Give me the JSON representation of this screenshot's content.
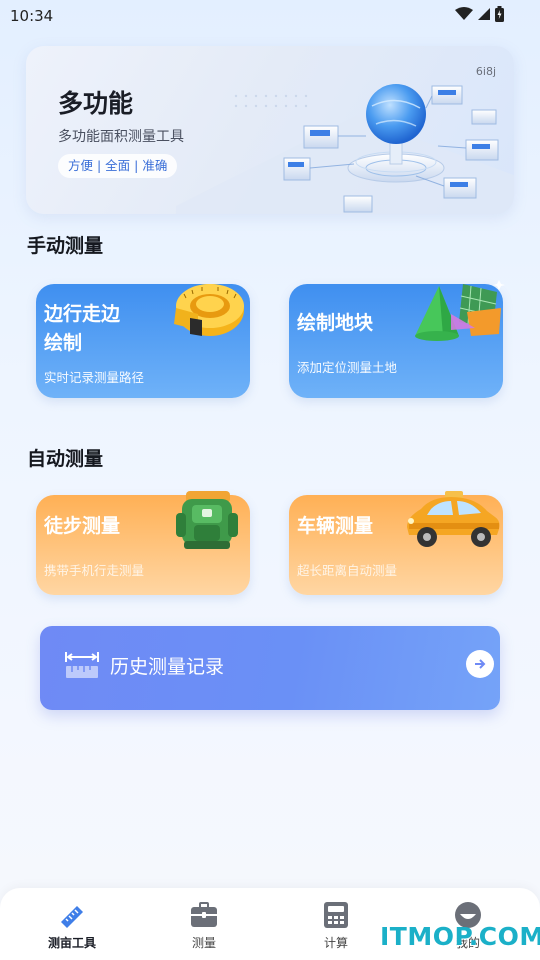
{
  "status_bar": {
    "time": "10:34"
  },
  "banner": {
    "title": "多功能",
    "subtitle": "多功能面积测量工具",
    "tags": "方便 | 全面 | 准确",
    "code": "6i8j"
  },
  "sections": {
    "manual": "手动测量",
    "auto": "自动测量"
  },
  "cards": {
    "walk_draw": {
      "title_line1": "边行走边",
      "title_line2": "绘制",
      "subtitle": "实时记录测量路径",
      "icon": "tape-measure-icon"
    },
    "draw_plot": {
      "title": "绘制地块",
      "subtitle": "添加定位测量土地",
      "icon": "geometry-tools-icon"
    },
    "hike": {
      "title": "徒步测量",
      "subtitle": "携带手机行走测量",
      "icon": "backpack-icon"
    },
    "vehicle": {
      "title": "车辆测量",
      "subtitle": "超长距离自动测量",
      "icon": "taxi-icon"
    }
  },
  "history": {
    "label": "历史测量记录"
  },
  "bottom_nav": [
    {
      "label": "测亩工具",
      "icon": "ruler-icon",
      "active": true
    },
    {
      "label": "测量",
      "icon": "briefcase-icon",
      "active": false
    },
    {
      "label": "计算",
      "icon": "calculator-icon",
      "active": false
    },
    {
      "label": "我的",
      "icon": "profile-icon",
      "active": false
    }
  ],
  "watermark": "ITMOP.COM",
  "colors": {
    "blue_card": "#3f8ff0",
    "orange_card": "#ffb055",
    "history": "#6f8af5",
    "accent": "#3b6fd8"
  }
}
